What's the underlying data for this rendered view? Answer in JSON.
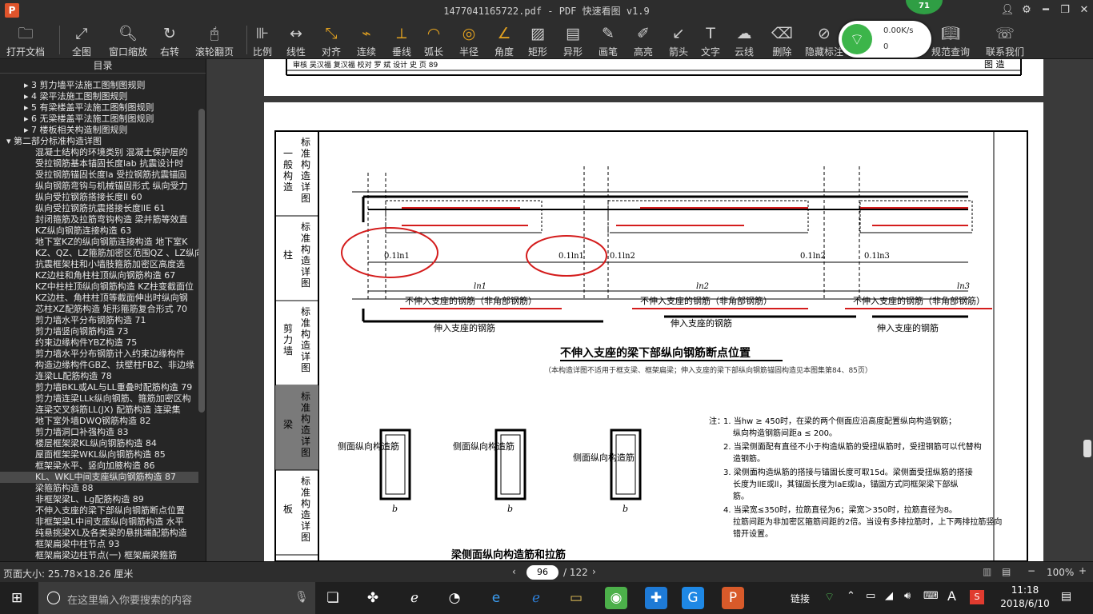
{
  "window": {
    "title": "1477041165722.pdf - PDF 快速看图 v1.9",
    "logo": "P",
    "update_badge": "71"
  },
  "toolbar": [
    {
      "label": "打开文档",
      "icon": "folder-icon",
      "glyph": "🗀"
    },
    {
      "label": "全图",
      "icon": "fit-icon",
      "glyph": "⤢"
    },
    {
      "label": "窗口缩放",
      "icon": "zoom-icon",
      "glyph": "🔍︎"
    },
    {
      "label": "右转",
      "icon": "rotate-icon",
      "glyph": "↻"
    },
    {
      "label": "滚轮翻页",
      "icon": "mouse-icon",
      "glyph": "🖰"
    },
    {
      "label": "比例",
      "icon": "scale-icon",
      "glyph": "⊪"
    },
    {
      "label": "线性",
      "icon": "linear-icon",
      "glyph": "↔"
    },
    {
      "label": "对齐",
      "icon": "align-icon",
      "glyph": "⤡"
    },
    {
      "label": "连续",
      "icon": "continuous-icon",
      "glyph": "⌁"
    },
    {
      "label": "垂线",
      "icon": "perpendicular-icon",
      "glyph": "⟂"
    },
    {
      "label": "弧长",
      "icon": "arc-icon",
      "glyph": "◠"
    },
    {
      "label": "半径",
      "icon": "radius-icon",
      "glyph": "◎"
    },
    {
      "label": "角度",
      "icon": "angle-icon",
      "glyph": "∠"
    },
    {
      "label": "矩形",
      "icon": "rectangle-icon",
      "glyph": "▨"
    },
    {
      "label": "异形",
      "icon": "shape-icon",
      "glyph": "▤"
    },
    {
      "label": "画笔",
      "icon": "pen-icon",
      "glyph": "✎"
    },
    {
      "label": "高亮",
      "icon": "highlight-icon",
      "glyph": "✐"
    },
    {
      "label": "箭头",
      "icon": "arrow-icon",
      "glyph": "↙"
    },
    {
      "label": "文字",
      "icon": "text-icon",
      "glyph": "T"
    },
    {
      "label": "云线",
      "icon": "cloud-icon",
      "glyph": "☁"
    },
    {
      "label": "删除",
      "icon": "eraser-icon",
      "glyph": "⌫"
    },
    {
      "label": "隐藏标注",
      "icon": "hide-icon",
      "glyph": "⊘"
    },
    {
      "label": "规范查询",
      "icon": "book-icon",
      "glyph": "📖︎"
    },
    {
      "label": "联系我们",
      "icon": "support-icon",
      "glyph": "☏"
    }
  ],
  "network": {
    "speed": "0.00K/s",
    "count": "0"
  },
  "sidebar": {
    "title": "目录",
    "items": [
      {
        "text": "▸  3  剪力墙平法施工图制图规则",
        "level": 2
      },
      {
        "text": "▸  4  梁平法施工图制图规则",
        "level": 2
      },
      {
        "text": "▸  5  有梁楼盖平法施工图制图规则",
        "level": 2
      },
      {
        "text": "▸  6  无梁楼盖平法施工图制图规则",
        "level": 2
      },
      {
        "text": "▸  7  楼板相关构造制图规则",
        "level": 2
      },
      {
        "text": "▾  第二部分标准构造详图",
        "level": 0
      },
      {
        "text": "混凝土结构的环境类别  混凝土保护层的",
        "level": 3
      },
      {
        "text": "受拉钢筋基本锚固长度lab  抗震设计时",
        "level": 3
      },
      {
        "text": "受拉钢筋锚固长度la  受拉钢筋抗震锚固",
        "level": 3
      },
      {
        "text": "纵向钢筋弯钩与机械锚固形式  纵向受力",
        "level": 3
      },
      {
        "text": "纵向受拉钢筋搭接长度ll  60",
        "level": 3
      },
      {
        "text": "纵向受拉钢筋抗震搭接长度llE  61",
        "level": 3
      },
      {
        "text": "封闭箍筋及拉筋弯钩构造  梁并筋等效直",
        "level": 3
      },
      {
        "text": "KZ纵向钢筋连接构造  63",
        "level": 3
      },
      {
        "text": "地下室KZ的纵向钢筋连接构造  地下室K",
        "level": 3
      },
      {
        "text": "KZ、QZ、LZ箍筋加密区范围QZ 、LZ纵向",
        "level": 3
      },
      {
        "text": "抗震框架柱和小墙肢箍筋加密区高度选",
        "level": 3
      },
      {
        "text": "KZ边柱和角柱柱顶纵向钢筋构造  67",
        "level": 3
      },
      {
        "text": "KZ中柱柱顶纵向钢筋构造  KZ柱变截面位",
        "level": 3
      },
      {
        "text": "KZ边柱、角柱柱顶等截面伸出时纵向钢",
        "level": 3
      },
      {
        "text": "芯柱XZ配筋构造  矩形箍筋复合形式  70",
        "level": 3
      },
      {
        "text": "剪力墙水平分布钢筋构造  71",
        "level": 3
      },
      {
        "text": "剪力墙竖向钢筋构造  73",
        "level": 3
      },
      {
        "text": "约束边缘构件YBZ构造  75",
        "level": 3
      },
      {
        "text": "剪力墙水平分布钢筋计入约束边缘构件",
        "level": 3
      },
      {
        "text": "构造边缘构件GBZ、扶壁柱FBZ、非边缘",
        "level": 3
      },
      {
        "text": "连梁LL配筋构造  78",
        "level": 3
      },
      {
        "text": "剪力墙BKL或AL与LL重叠时配筋构造  79",
        "level": 3
      },
      {
        "text": "剪力墙连梁LLk纵向钢筋、箍筋加密区构",
        "level": 3
      },
      {
        "text": "连梁交叉斜筋LL(JX) 配筋构造  连梁集",
        "level": 3
      },
      {
        "text": "地下室外墙DWQ钢筋构造  82",
        "level": 3
      },
      {
        "text": "剪力墙洞口补强构造  83",
        "level": 3
      },
      {
        "text": "楼层框架梁KL纵向钢筋构造  84",
        "level": 3
      },
      {
        "text": "屋面框架梁WKL纵向钢筋构造  85",
        "level": 3
      },
      {
        "text": "框架梁水平、竖向加腋构造  86",
        "level": 3
      },
      {
        "text": "KL、WKL中间支座纵向钢筋构造  87",
        "level": 3,
        "selected": true
      },
      {
        "text": "梁箍筋构造  88",
        "level": 3
      },
      {
        "text": "非框架梁L、Lg配筋构造  89",
        "level": 3
      },
      {
        "text": "不伸入支座的梁下部纵向钢筋断点位置",
        "level": 3
      },
      {
        "text": "非框架梁L中间支座纵向钢筋构造  水平",
        "level": 3
      },
      {
        "text": "纯悬挑梁XL及各类梁的悬挑端配筋构造",
        "level": 3
      },
      {
        "text": "框架扁梁中柱节点  93",
        "level": 3
      },
      {
        "text": "框架扁梁边柱节点(一) 框架扁梁箍筋",
        "level": 3
      }
    ]
  },
  "document": {
    "header_row": "审核  吴汉福  复汉福  校对  罗 斌  设计  史  页  89",
    "header_label": "图 造",
    "side_sections": [
      {
        "cat": "一般构造",
        "sub": "标准构造详图"
      },
      {
        "cat": "柱",
        "sub": "标准构造详图"
      },
      {
        "cat": "剪力墙",
        "sub": "标准构造详图"
      },
      {
        "cat": "梁",
        "sub": "标准构造详图",
        "active": true
      },
      {
        "cat": "板",
        "sub": "标准构造详图"
      }
    ],
    "dims": [
      "0.1ln1",
      "0.1ln1",
      "0.1ln2",
      "0.1ln2",
      "0.1ln3"
    ],
    "spans": [
      "ln1",
      "ln2",
      "ln3"
    ],
    "red_note": "不伸入支座的钢筋（非角部钢筋）",
    "bottom_note": "伸入支座的钢筋",
    "diagram_title": "不伸入支座的梁下部纵向钢筋断点位置",
    "diagram_caption": "（本构造详图不适用于框支梁、框架扁梁；伸入支座的梁下部纵向钢筋锚固构造见本图集第84、85页）",
    "section_label": "侧面纵向构造筋",
    "section_dims": [
      "a",
      "a",
      "a",
      "hw",
      "b"
    ],
    "section_title": "梁侧面纵向构造筋和拉筋",
    "notes_label": "注：",
    "notes": [
      "1. 当hw ≥ 450时，在梁的两个侧面应沿高度配置纵向构造钢筋；纵向构造钢筋间距a ≤ 200。",
      "2. 当梁侧面配有直径不小于构造纵筋的受扭纵筋时，受扭钢筋可以代替构造钢筋。",
      "3. 梁侧面构造纵筋的搭接与锚固长度可取15d。梁侧面受扭纵筋的搭接长度为llE或ll，其锚固长度为laE或la，锚固方式同框架梁下部纵筋。",
      "4. 当梁宽≤350时，拉筋直径为6；梁宽＞350时，拉筋直径为8。拉筋间距为非加密区箍筋间距的2倍。当设有多排拉筋时，上下两排拉筋竖向错开设置。"
    ],
    "accent_red": "#d41c1c"
  },
  "statusbar": {
    "page_size": "页面大小: 25.78×18.26 厘米",
    "current_page": "96",
    "total_pages": "/ 122",
    "zoom": "100%"
  },
  "taskbar": {
    "search_placeholder": "在这里输入你要搜索的内容",
    "link_label": "链接",
    "ime": "A",
    "time": "11:18",
    "date": "2018/6/10"
  }
}
